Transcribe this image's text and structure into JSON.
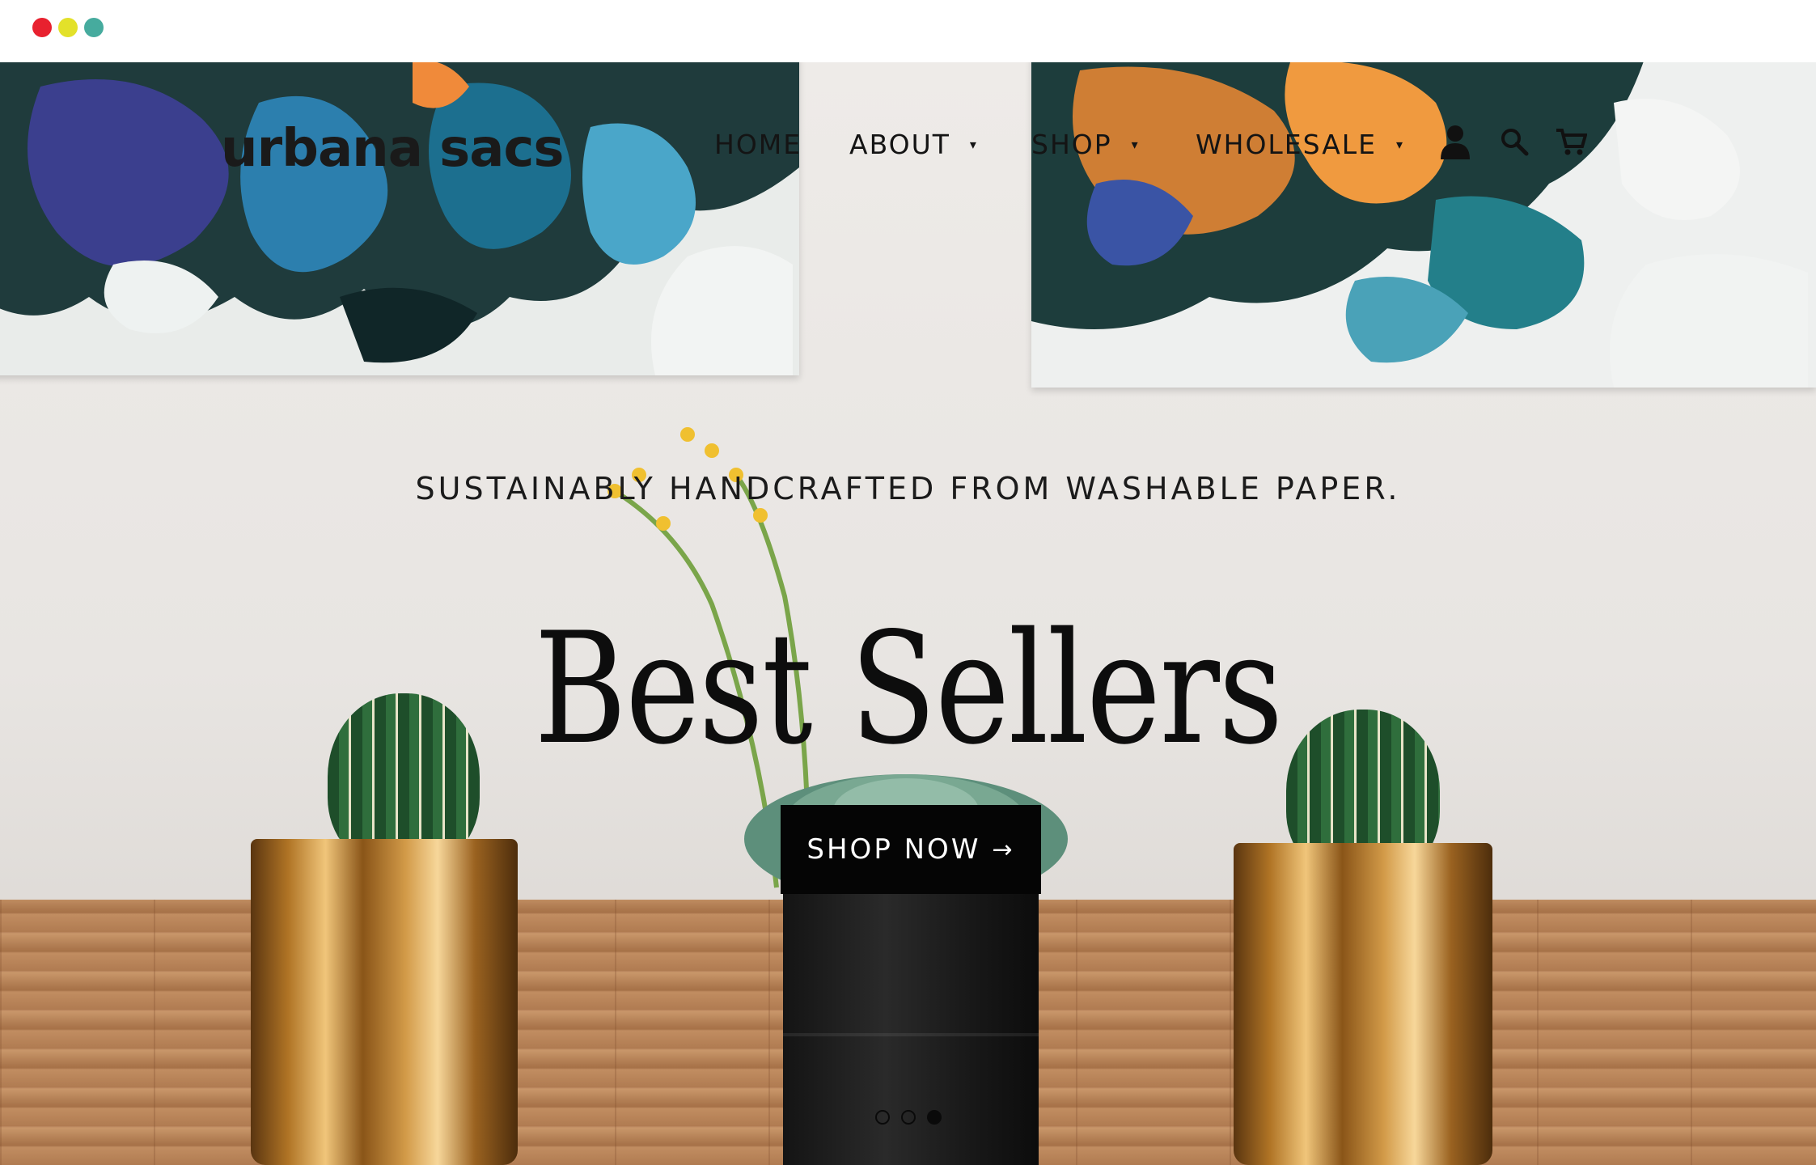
{
  "window": {
    "controls": [
      "close",
      "minimize",
      "maximize"
    ]
  },
  "header": {
    "logo_text": "urbana sacs",
    "nav": [
      {
        "label": "HOME",
        "has_dropdown": false
      },
      {
        "label": "ABOUT",
        "has_dropdown": true
      },
      {
        "label": "SHOP",
        "has_dropdown": true
      },
      {
        "label": "WHOLESALE",
        "has_dropdown": true
      }
    ],
    "caret": "▾",
    "icons": [
      "account-icon",
      "search-icon",
      "cart-icon"
    ]
  },
  "hero": {
    "subtitle": "SUSTAINABLY HANDCRAFTED FROM WASHABLE PAPER.",
    "headline": "Best Sellers",
    "cta_label": "SHOP NOW",
    "cta_arrow": "→",
    "slide_count": 3,
    "active_slide": 3
  },
  "colors": {
    "cta_background": "#050505",
    "window_close": "#e8212f",
    "window_minimize": "#e3e12a",
    "window_maximize": "#46ab9e"
  }
}
